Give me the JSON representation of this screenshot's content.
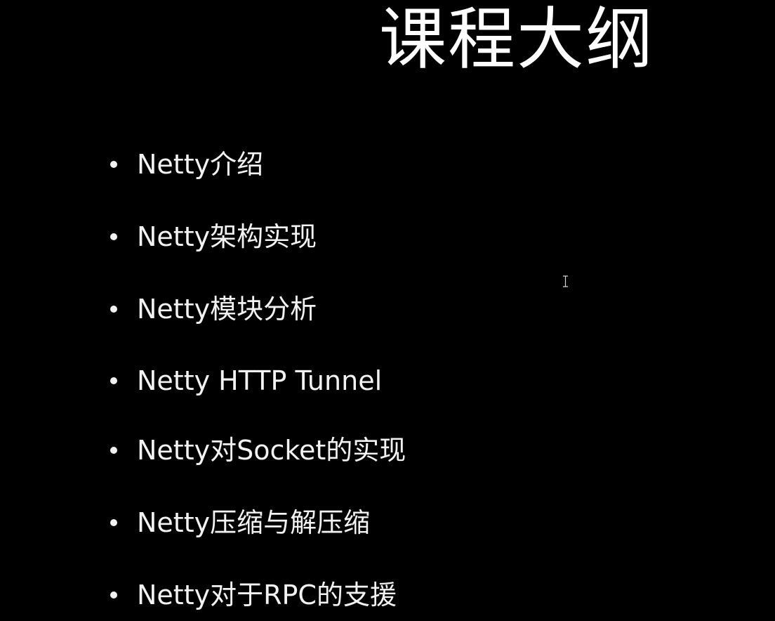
{
  "slide": {
    "title": "课程大纲",
    "bullets": [
      {
        "text": "Netty介绍"
      },
      {
        "text": "Netty架构实现"
      },
      {
        "text": "Netty模块分析"
      },
      {
        "text": "Netty HTTP Tunnel"
      },
      {
        "text": "Netty对Socket的实现"
      },
      {
        "text": "Netty压缩与解压缩"
      },
      {
        "text": "Netty对于RPC的支援"
      }
    ]
  },
  "cursor": {
    "icon": "text-cursor-icon"
  },
  "colors": {
    "background": "#000000",
    "text": "#f2f2f2",
    "title": "#ffffff"
  }
}
